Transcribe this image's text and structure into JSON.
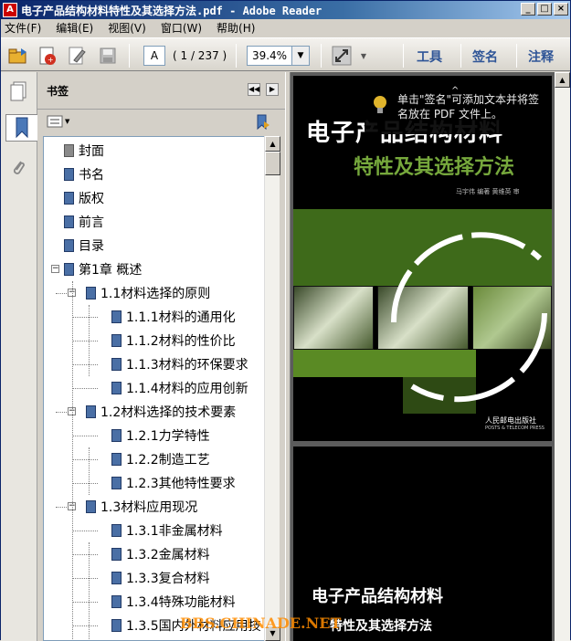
{
  "window": {
    "title": "电子产品结构材料特性及其选择方法.pdf - Adobe Reader",
    "app_icon_label": "A",
    "buttons": {
      "minimize": "_",
      "maximize": "□",
      "close": "×"
    }
  },
  "menu": [
    "文件(F)",
    "编辑(E)",
    "视图(V)",
    "窗口(W)",
    "帮助(H)"
  ],
  "toolbar": {
    "page_input": "A",
    "page_count": "( 1 / 237 )",
    "zoom": "39.4%",
    "tools_label": "工具",
    "sign_label": "签名",
    "comment_label": "注释"
  },
  "bookmarks_panel": {
    "title": "书签",
    "items": [
      {
        "label": "封面",
        "level": 0,
        "type": "page"
      },
      {
        "label": "书名",
        "level": 0,
        "type": "bookmark"
      },
      {
        "label": "版权",
        "level": 0,
        "type": "bookmark"
      },
      {
        "label": "前言",
        "level": 0,
        "type": "bookmark"
      },
      {
        "label": "目录",
        "level": 0,
        "type": "bookmark"
      },
      {
        "label": "第1章  概述",
        "level": 0,
        "type": "bookmark",
        "toggle": "−"
      },
      {
        "label": "1.1材料选择的原则",
        "level": 1,
        "type": "bookmark",
        "toggle": "−"
      },
      {
        "label": "1.1.1材料的通用化",
        "level": 2,
        "type": "bookmark"
      },
      {
        "label": "1.1.2材料的性价比",
        "level": 2,
        "type": "bookmark"
      },
      {
        "label": "1.1.3材料的环保要求",
        "level": 2,
        "type": "bookmark"
      },
      {
        "label": "1.1.4材料的应用创新",
        "level": 2,
        "type": "bookmark"
      },
      {
        "label": "1.2材料选择的技术要素",
        "level": 1,
        "type": "bookmark",
        "toggle": "−"
      },
      {
        "label": "1.2.1力学特性",
        "level": 2,
        "type": "bookmark"
      },
      {
        "label": "1.2.2制造工艺",
        "level": 2,
        "type": "bookmark"
      },
      {
        "label": "1.2.3其他特性要求",
        "level": 2,
        "type": "bookmark"
      },
      {
        "label": "1.3材料应用现况",
        "level": 1,
        "type": "bookmark",
        "toggle": "−"
      },
      {
        "label": "1.3.1非金属材料",
        "level": 2,
        "type": "bookmark"
      },
      {
        "label": "1.3.2金属材料",
        "level": 2,
        "type": "bookmark"
      },
      {
        "label": "1.3.3复合材料",
        "level": 2,
        "type": "bookmark"
      },
      {
        "label": "1.3.4特殊功能材料",
        "level": 2,
        "type": "bookmark"
      },
      {
        "label": "1.3.5国内外材料应用技",
        "level": 2,
        "type": "bookmark"
      }
    ]
  },
  "tooltip": {
    "text": "单击\"签名\"可添加文本并将签名放在 PDF 文件上。"
  },
  "document": {
    "cover_title": "电子产品结构材料",
    "cover_subtitle": "特性及其选择方法",
    "cover_authors": "马宇伟  编著    黄维英  审",
    "publisher": "人民邮电出版社",
    "publisher_en": "POSTS & TELECOM PRESS",
    "page2_title": "电子产品结构材料",
    "page2_subtitle": "特性及其选择方法"
  },
  "watermark": "BBS.CHINADE.NET",
  "colors": {
    "title_bar": "#0a246a",
    "cover_green": "#5a8a24",
    "watermark": "#ff8c00"
  }
}
